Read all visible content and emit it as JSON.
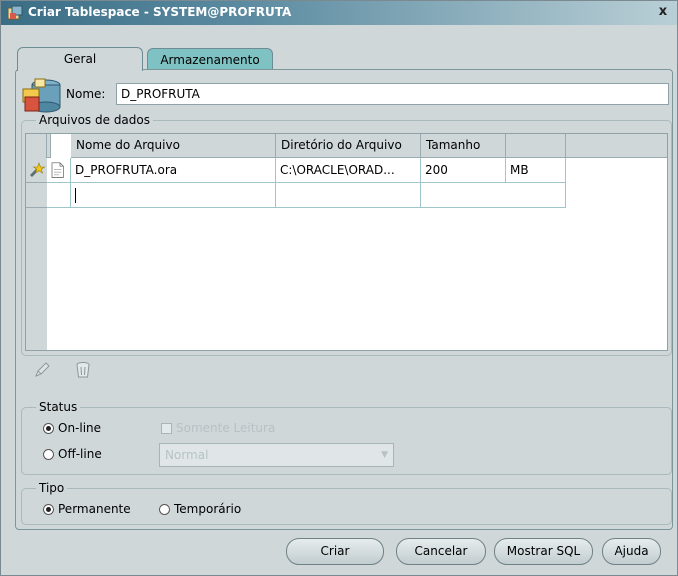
{
  "window": {
    "title": "Criar Tablespace - SYSTEM@PROFRUTA",
    "close_glyph": "x"
  },
  "tabs": [
    {
      "label": "Geral",
      "active": true
    },
    {
      "label": "Armazenamento",
      "active": false
    }
  ],
  "general": {
    "icon": "database-tablespace-icon",
    "name_label": "Nome:",
    "name_value": "D_PROFRUTA"
  },
  "datafiles": {
    "title": "Arquivos de dados",
    "columns": [
      "Nome do Arquivo",
      "Diretório do Arquivo",
      "Tamanho",
      ""
    ],
    "rows": [
      {
        "file": "D_PROFRUTA.ora",
        "dir": "C:\\ORACLE\\ORAD...",
        "size": "200",
        "unit": "MB"
      }
    ],
    "tools": [
      "edit-pencil-icon",
      "trash-icon"
    ]
  },
  "status": {
    "title": "Status",
    "online_label": "On-line",
    "offline_label": "Off-line",
    "readonly_label": "Somente Leitura",
    "offline_mode": "Normal",
    "selected": "online"
  },
  "type": {
    "title": "Tipo",
    "permanent_label": "Permanente",
    "temporary_label": "Temporário",
    "selected": "permanent"
  },
  "buttons": {
    "create": "Criar",
    "cancel": "Cancelar",
    "show_sql": "Mostrar SQL",
    "help": "Ajuda"
  },
  "colors": {
    "title_bar": "#3a6e86",
    "tab_inactive": "#7fc2c3",
    "panel_bg": "#cfd7d9"
  }
}
